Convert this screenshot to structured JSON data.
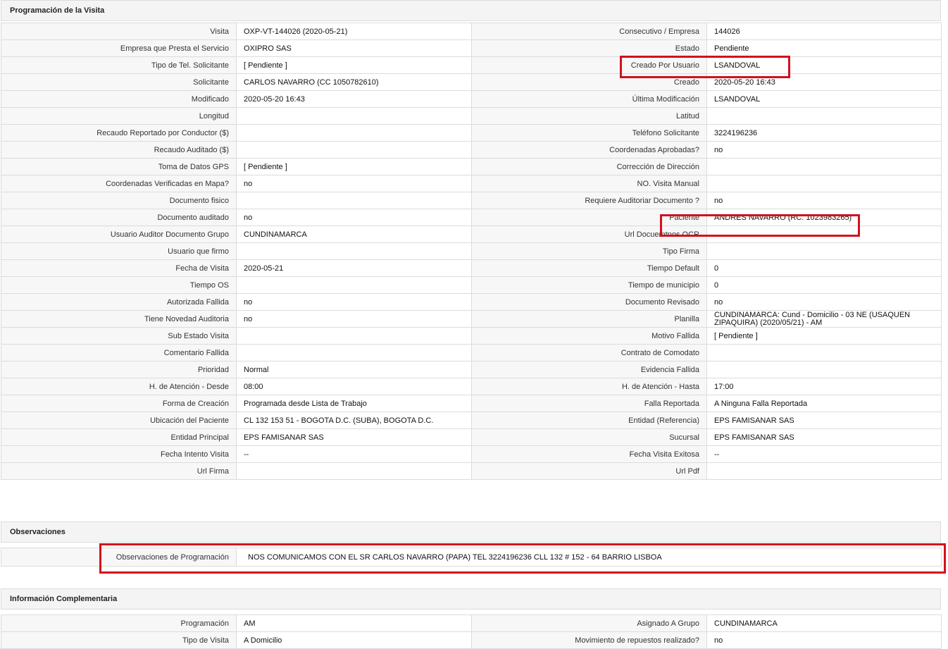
{
  "section1": {
    "title": "Programación de la Visita",
    "rows": [
      {
        "l1": "Visita",
        "v1": "OXP-VT-144026 (2020-05-21)",
        "l2": "Consecutivo / Empresa",
        "v2": "144026"
      },
      {
        "l1": "Empresa que Presta el Servicio",
        "v1": "OXIPRO SAS",
        "l2": "Estado",
        "v2": "Pendiente"
      },
      {
        "l1": "Tipo de Tel. Solicitante",
        "v1": "[ Pendiente ]",
        "l2": "Creado Por Usuario",
        "v2": "LSANDOVAL"
      },
      {
        "l1": "Solicitante",
        "v1": "CARLOS NAVARRO (CC 1050782610)",
        "l2": "Creado",
        "v2": "2020-05-20 16:43"
      },
      {
        "l1": "Modificado",
        "v1": "2020-05-20 16:43",
        "l2": "Última Modificación",
        "v2": " LSANDOVAL"
      },
      {
        "l1": "Longitud",
        "v1": "",
        "l2": "Latitud",
        "v2": ""
      },
      {
        "l1": "Recaudo Reportado por Conductor ($)",
        "v1": "",
        "l2": "Teléfono Solicitante",
        "v2": "3224196236"
      },
      {
        "l1": "Recaudo Auditado ($)",
        "v1": "",
        "l2": "Coordenadas Aprobadas?",
        "v2": " no"
      },
      {
        "l1": "Toma de Datos GPS",
        "v1": "[ Pendiente ]",
        "l2": "Corrección de Dirección",
        "v2": ""
      },
      {
        "l1": "Coordenadas Verificadas en Mapa?",
        "v1": " no",
        "l2": "NO. Visita Manual",
        "v2": ""
      },
      {
        "l1": "Documento fisico",
        "v1": "",
        "l2": "Requiere Auditoriar Documento ?",
        "v2": " no"
      },
      {
        "l1": "Documento auditado",
        "v1": " no",
        "l2": "Paciente",
        "v2": "ANDRES NAVARRO (RC: 1023983265)"
      },
      {
        "l1": "Usuario Auditor Documento Grupo",
        "v1": "CUNDINAMARCA",
        "l2": "Url Docuemtnos OCR",
        "v2": ""
      },
      {
        "l1": "Usuario que firmo",
        "v1": "",
        "l2": "Tipo Firma",
        "v2": ""
      },
      {
        "l1": "Fecha de Visita",
        "v1": " 2020-05-21",
        "l2": "Tiempo Default",
        "v2": "0"
      },
      {
        "l1": "Tiempo OS",
        "v1": "",
        "l2": "Tiempo de municipio",
        "v2": "0"
      },
      {
        "l1": "Autorizada Fallida",
        "v1": " no",
        "l2": "Documento Revisado",
        "v2": " no"
      },
      {
        "l1": "Tiene Novedad Auditoria",
        "v1": " no",
        "l2": "Planilla",
        "v2": "CUNDINAMARCA: Cund - Domicilio - 03 NE (USAQUEN ZIPAQUIRA) (2020/05/21) - AM"
      },
      {
        "l1": "Sub Estado Visita",
        "v1": "",
        "l2": "Motivo Fallida",
        "v2": "[ Pendiente ]"
      },
      {
        "l1": "Comentario Fallida",
        "v1": "",
        "l2": "Contrato de Comodato",
        "v2": ""
      },
      {
        "l1": "Prioridad",
        "v1": "Normal",
        "l2": "Evidencia Fallida",
        "v2": ""
      },
      {
        "l1": "H. de Atención - Desde",
        "v1": "08:00",
        "l2": "H. de Atención - Hasta",
        "v2": "17:00"
      },
      {
        "l1": "Forma de Creación",
        "v1": "Programada desde Lista de Trabajo",
        "l2": "Falla Reportada",
        "v2": "A Ninguna Falla Reportada"
      },
      {
        "l1": "Ubicación del Paciente",
        "v1": "CL 132 153 51 - BOGOTA D.C. (SUBA), BOGOTA D.C.",
        "l2": "Entidad (Referencia)",
        "v2": "EPS FAMISANAR SAS"
      },
      {
        "l1": "Entidad Principal",
        "v1": "EPS FAMISANAR SAS",
        "l2": "Sucursal",
        "v2": "EPS FAMISANAR SAS"
      },
      {
        "l1": "Fecha Intento Visita",
        "v1": " --",
        "l2": "Fecha Visita Exitosa",
        "v2": " --"
      },
      {
        "l1": "Url Firma",
        "v1": "",
        "l2": "Url Pdf",
        "v2": ""
      }
    ]
  },
  "section2": {
    "title": "Observaciones",
    "label": "Observaciones de Programación",
    "value": "NOS COMUNICAMOS CON EL SR CARLOS NAVARRO (PAPA) TEL 3224196236 CLL 132 # 152 - 64 BARRIO LISBOA"
  },
  "section3": {
    "title": "Información Complementaria",
    "rows": [
      {
        "l1": "Programación",
        "v1": "AM",
        "l2": "Asignado A Grupo",
        "v2": "CUNDINAMARCA"
      },
      {
        "l1": "Tipo de Visita",
        "v1": "A Domicilio",
        "l2": "Movimiento de repuestos realizado?",
        "v2": " no"
      }
    ]
  },
  "highlight_color": "#d2111d"
}
